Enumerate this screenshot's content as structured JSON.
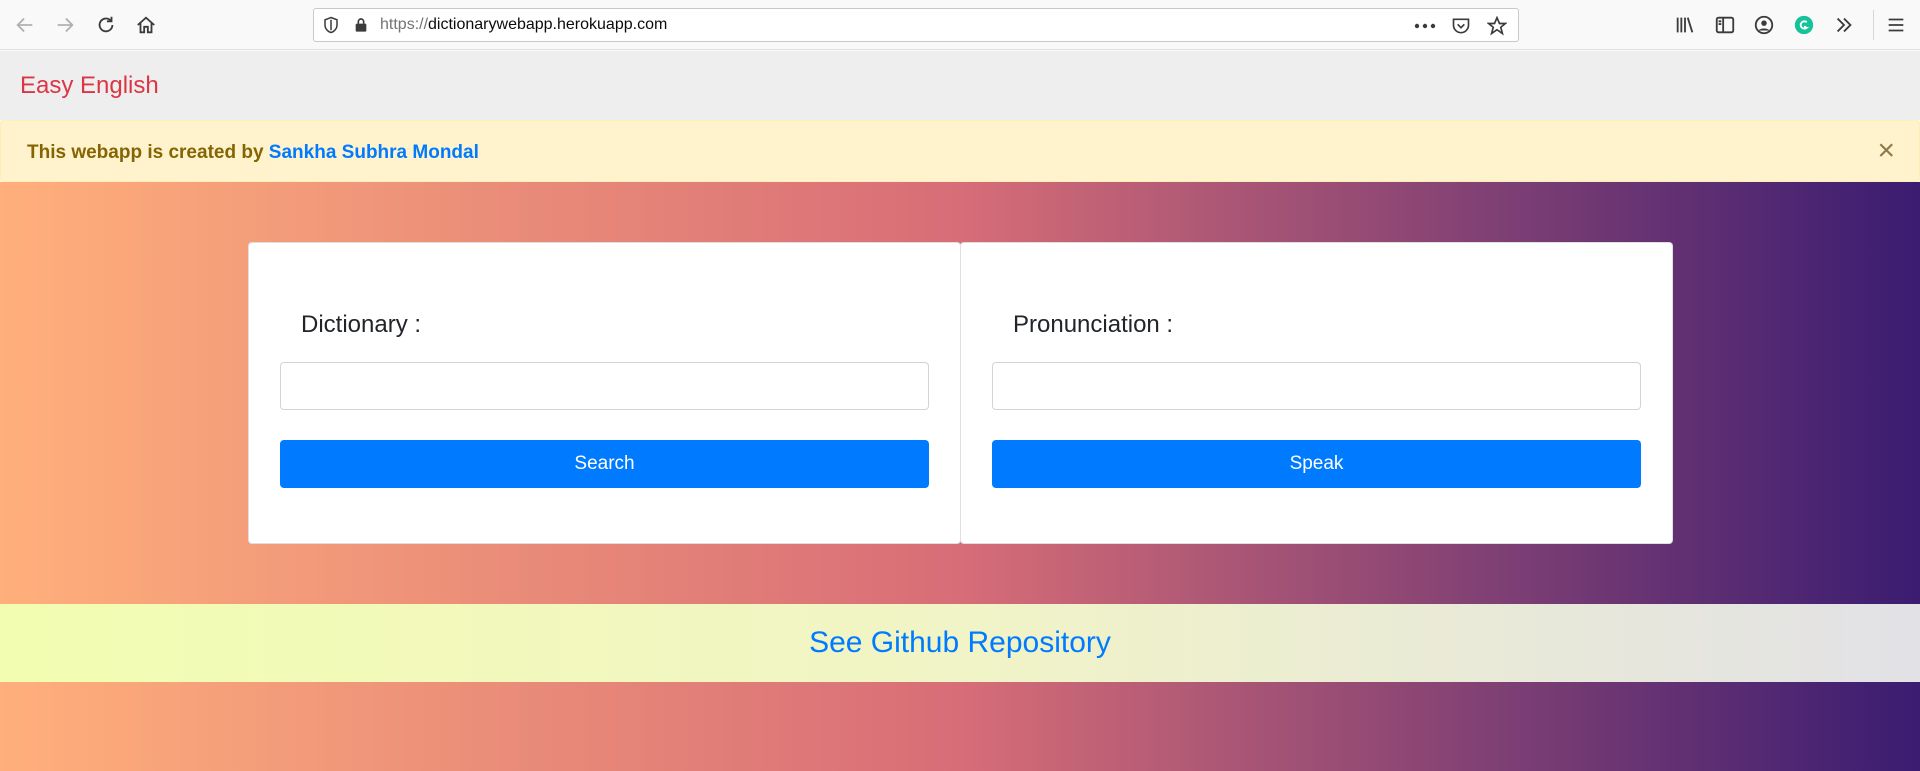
{
  "browser": {
    "url_protocol": "https://",
    "url_host": "dictionarywebapp.herokuapp.com",
    "icons": {
      "back": "back-arrow-icon",
      "forward": "forward-arrow-icon",
      "reload": "reload-icon",
      "home": "home-icon",
      "shield": "tracking-protection-shield-icon",
      "lock": "lock-icon",
      "more": "more-actions-icon",
      "pocket": "pocket-icon",
      "bookmark": "star-bookmark-icon",
      "library": "library-icon",
      "sidebar": "sidebar-icon",
      "account": "account-icon",
      "grammarly": "grammarly-icon",
      "overflow": "overflow-chevrons-icon",
      "menu": "hamburger-menu-icon"
    }
  },
  "navbar": {
    "brand": "Easy English"
  },
  "alert": {
    "text": "This webapp is created by ",
    "author": "Sankha Subhra Mondal",
    "close": "×"
  },
  "dictionary": {
    "title": "Dictionary :",
    "input_value": "",
    "button": "Search"
  },
  "pronunciation": {
    "title": "Pronunciation :",
    "input_value": "",
    "button": "Speak"
  },
  "footer_link": "See Github Repository",
  "colors": {
    "brand": "#dc3545",
    "primary": "#007bff",
    "alert_bg": "#fff3cd",
    "alert_text": "#856404",
    "gradient": [
      "#ffaf7b",
      "#d76d77",
      "#3a1c71"
    ]
  }
}
